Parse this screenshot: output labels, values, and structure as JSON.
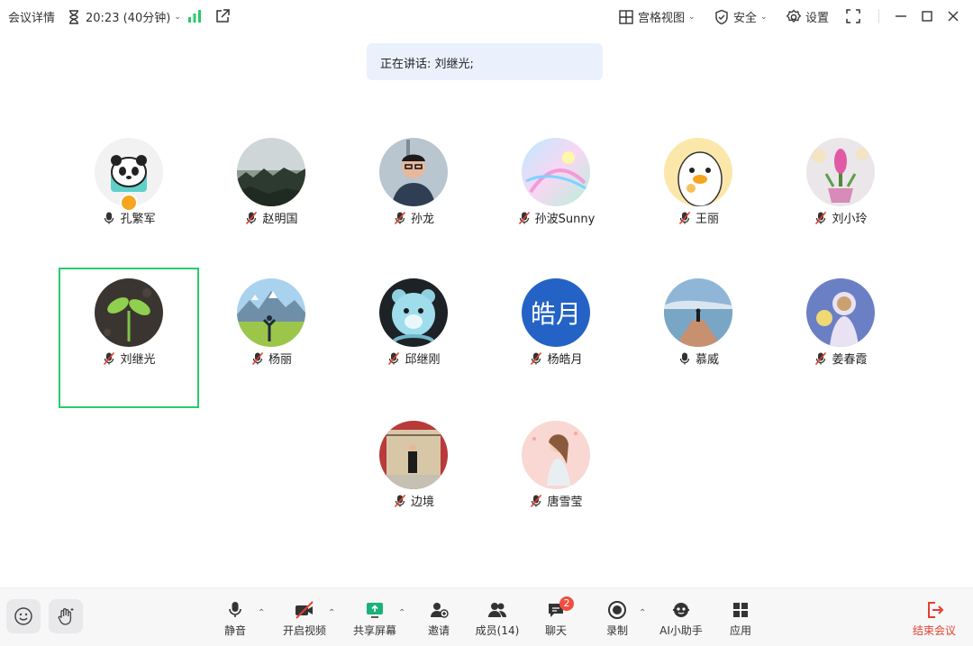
{
  "topbar": {
    "meeting_details": "会议详情",
    "timer": "20:23 (40分钟)",
    "grid_view": "宫格视图",
    "security": "安全",
    "settings": "设置"
  },
  "speaking": "正在讲话: 刘继光;",
  "participants": [
    {
      "name": "孔繁军",
      "mic": "on",
      "host": true,
      "avatar": "panda-avatar"
    },
    {
      "name": "赵明国",
      "mic": "muted",
      "avatar": "misty-forest-avatar"
    },
    {
      "name": "孙龙",
      "mic": "muted",
      "avatar": "person-photo-avatar"
    },
    {
      "name": "孙波Sunny",
      "mic": "muted",
      "avatar": "pastel-art-avatar"
    },
    {
      "name": "王丽",
      "mic": "muted",
      "avatar": "cartoon-duck-avatar"
    },
    {
      "name": "刘小玲",
      "mic": "muted",
      "avatar": "hyacinth-avatar"
    },
    {
      "name": "刘继光",
      "mic": "muted",
      "active": true,
      "avatar": "sprout-avatar"
    },
    {
      "name": "杨丽",
      "mic": "muted",
      "avatar": "mountain-field-avatar"
    },
    {
      "name": "邱继刚",
      "mic": "muted",
      "avatar": "toy-bear-avatar"
    },
    {
      "name": "杨皓月",
      "mic": "muted",
      "avatar": "text-avatar",
      "avatar_text": "皓月"
    },
    {
      "name": "慕威",
      "mic": "on",
      "avatar": "pier-lake-avatar"
    },
    {
      "name": "姜春霞",
      "mic": "muted",
      "avatar": "astronaut-avatar"
    },
    {
      "name": "边境",
      "mic": "muted",
      "avatar": "building-photo-avatar"
    },
    {
      "name": "唐雪莹",
      "mic": "muted",
      "avatar": "girl-illustration-avatar"
    }
  ],
  "toolbar": {
    "mute": "静音",
    "start_video": "开启视频",
    "share_screen": "共享屏幕",
    "invite": "邀请",
    "members": "成员(14)",
    "chat": "聊天",
    "chat_badge": "2",
    "record": "录制",
    "ai_assistant": "AI小助手",
    "apps": "应用",
    "end_meeting": "结束会议"
  },
  "colors": {
    "accent_green": "#2bc96a",
    "end_red": "#e5402f",
    "banner_bg": "#eaf1fd"
  }
}
